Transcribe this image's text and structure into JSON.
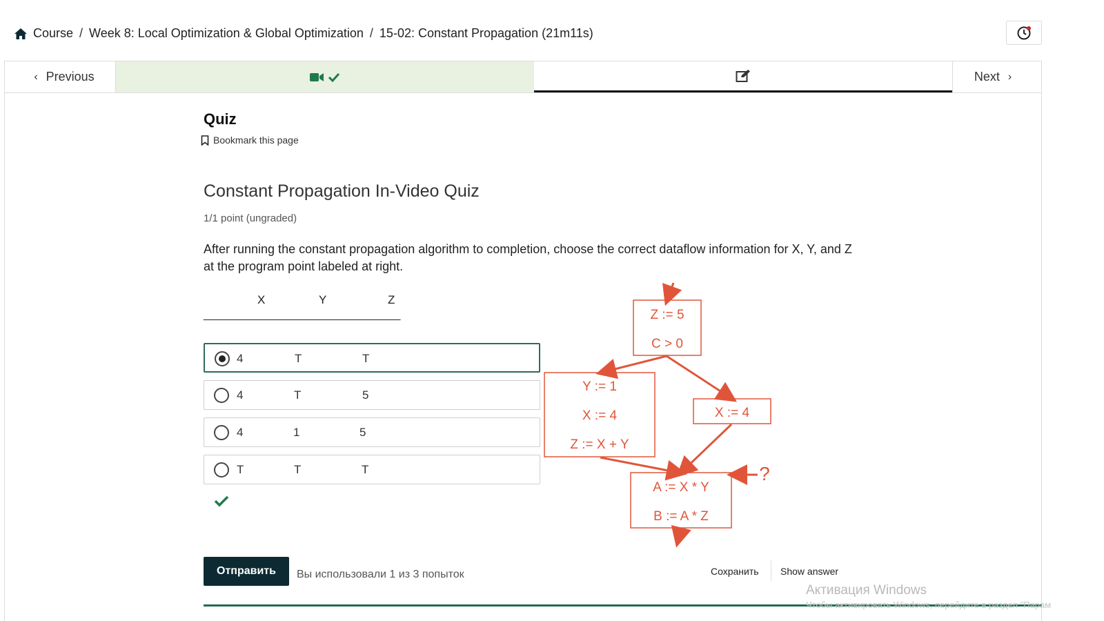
{
  "breadcrumb": {
    "items": [
      "Course",
      "Week 8: Local Optimization & Global Optimization",
      "15-02: Constant Propagation (21m11s)"
    ],
    "separator": "/"
  },
  "nav": {
    "previous_label": "Previous",
    "next_label": "Next"
  },
  "quiz": {
    "heading": "Quiz",
    "bookmark_label": "Bookmark this page"
  },
  "problem": {
    "title": "Constant Propagation In-Video Quiz",
    "points": "1/1 point (ungraded)",
    "question": "After running the constant propagation algorithm to completion, choose the correct dataflow information for X, Y, and Z at the program point labeled at right.",
    "columns": [
      "X",
      "Y",
      "Z"
    ],
    "underline": "____________________________________",
    "choices": [
      {
        "x": "4",
        "y": "T",
        "z": "T",
        "selected": true
      },
      {
        "x": "4",
        "y": "T",
        "z": "5",
        "selected": false
      },
      {
        "x": "4",
        "y": "1",
        "z": "5",
        "selected": false
      },
      {
        "x": "T",
        "y": "T",
        "z": "T",
        "selected": false
      }
    ]
  },
  "diagram": {
    "top_block": [
      "Z := 5",
      "C > 0"
    ],
    "left_block": [
      "Y := 1",
      "X := 4",
      "Z := X + Y"
    ],
    "right_block": [
      "X := 4"
    ],
    "bottom_block": [
      "A := X * Y",
      "B := A * Z"
    ],
    "question_mark": "?",
    "color": "#e0553a"
  },
  "actions": {
    "submit_label": "Отправить",
    "attempts_text": "Вы использовали 1 из 3 попыток",
    "save_label": "Сохранить",
    "show_answer_label": "Show answer"
  },
  "watermark": {
    "title": "Активация Windows",
    "subtitle": "Чтобы активировать Windows, перейдите в раздел \"Парам"
  },
  "colors": {
    "accent": "#0d2a33",
    "success": "#1f7a4d",
    "video_tab_bg": "#e9f2e1"
  }
}
